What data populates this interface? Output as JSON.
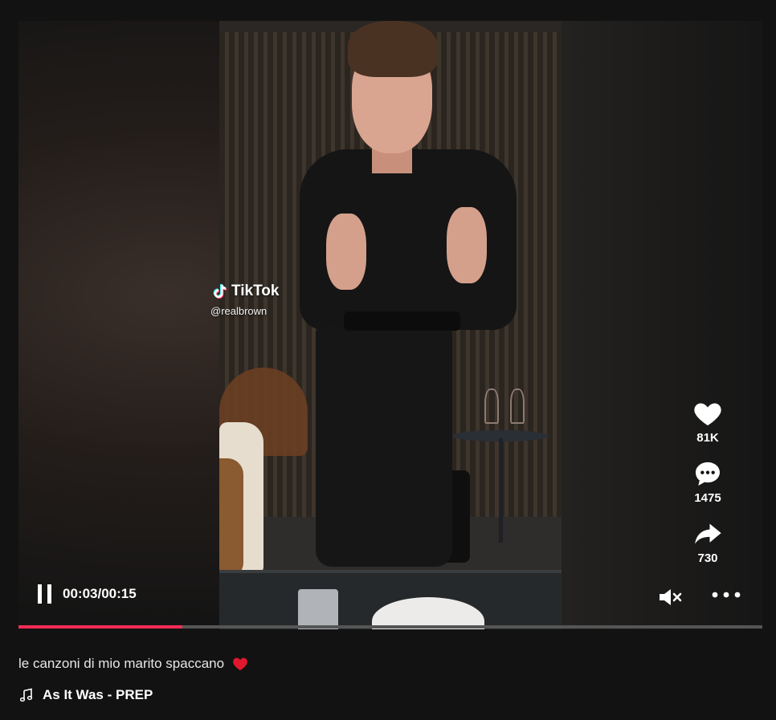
{
  "video": {
    "watermark_brand": "TikTok",
    "watermark_handle": "@realbrown",
    "playback_state": "playing",
    "time": "00:03/00:15",
    "progress_fraction": 0.22,
    "muted": true
  },
  "actions": {
    "likes": "81K",
    "comments": "1475",
    "shares": "730"
  },
  "caption": {
    "text": "le canzoni di mio marito spaccano",
    "emoji": "❤️"
  },
  "music": {
    "title": "As It Was - PREP"
  },
  "icons": {
    "like": "heart-icon",
    "comment": "comment-icon",
    "share": "share-icon",
    "mute": "volume-muted-icon",
    "more": "more-icon",
    "music": "music-note-icon",
    "pause": "pause-icon"
  },
  "colors": {
    "progress": "#fe2c55",
    "background": "#121212",
    "heart_emoji": "#e0182d"
  }
}
